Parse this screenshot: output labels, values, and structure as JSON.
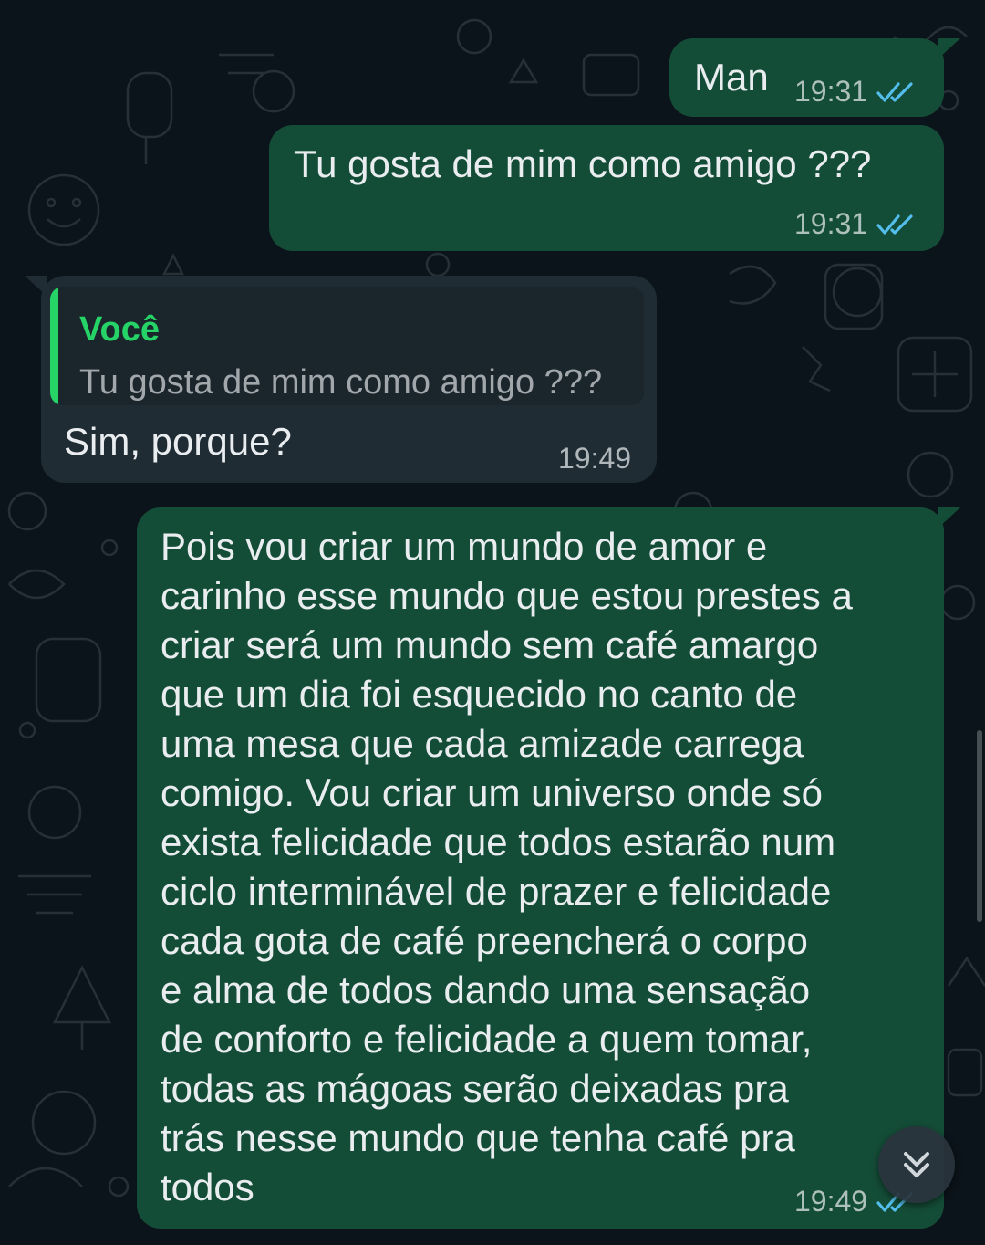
{
  "colors": {
    "background": "#0b141a",
    "outgoing_bubble": "#144d37",
    "incoming_bubble": "#1f2c34",
    "read_ticks": "#53bdeb",
    "quote_accent": "#25d366"
  },
  "messages": [
    {
      "direction": "outgoing",
      "text": "Man",
      "time": "19:31",
      "status_icon": "double-check-read-icon"
    },
    {
      "direction": "outgoing",
      "text": "Tu gosta de mim como amigo ???",
      "time": "19:31",
      "status_icon": "double-check-read-icon"
    },
    {
      "direction": "incoming",
      "quote": {
        "author": "Você",
        "text": "Tu gosta de mim como amigo ???"
      },
      "text": "Sim, porque?",
      "time": "19:49"
    },
    {
      "direction": "outgoing",
      "text": "Pois vou criar um mundo de amor e\ncarinho esse mundo que estou prestes a\ncriar será um mundo sem café amargo\nque um dia foi esquecido no canto de\numa mesa que cada amizade carrega\ncomigo. Vou criar um universo onde só\nexista felicidade que todos estarão num\nciclo interminável de prazer e felicidade\ncada gota de café preencherá o corpo\ne alma de todos dando uma sensação\nde conforto e felicidade a quem tomar,\ntodas as mágoas serão deixadas pra\ntrás nesse mundo que tenha café pra\ntodos",
      "time": "19:49",
      "status_icon": "double-check-read-icon"
    }
  ],
  "scroll_to_bottom": {
    "icon": "chevrons-down-icon"
  }
}
